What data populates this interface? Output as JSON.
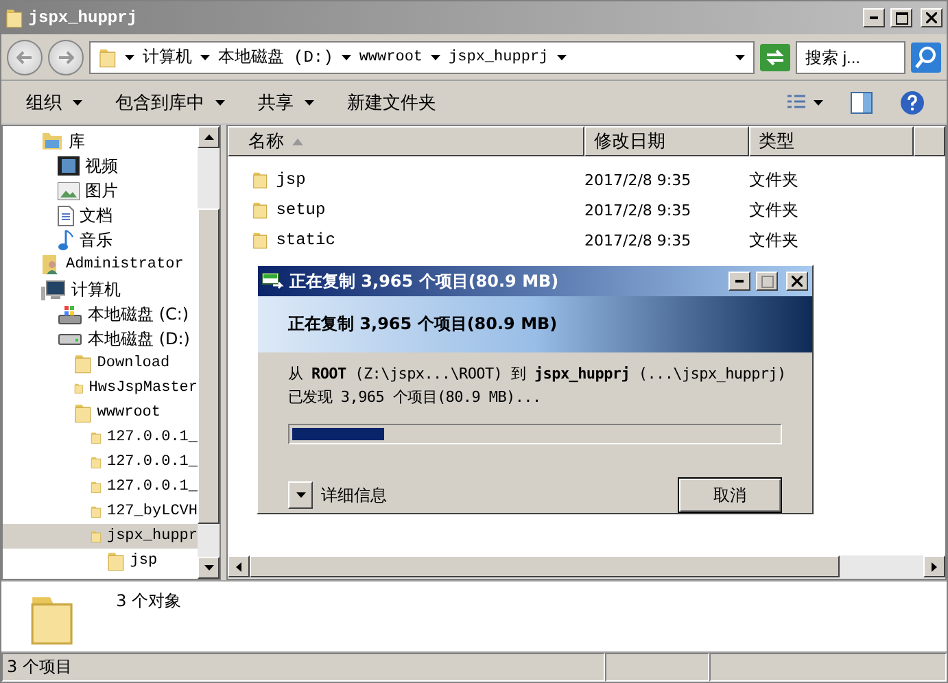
{
  "window": {
    "title": "jspx_hupprj"
  },
  "address_bar": {
    "path": [
      "计算机",
      "本地磁盘 (D:)",
      "wwwroot",
      "jspx_hupprj"
    ],
    "search": {
      "placeholder": "搜索 j..."
    }
  },
  "toolbar": {
    "items": [
      {
        "label": "组织",
        "dropdown": true
      },
      {
        "label": "包含到库中",
        "dropdown": true
      },
      {
        "label": "共享",
        "dropdown": true
      },
      {
        "label": "新建文件夹",
        "dropdown": false
      }
    ]
  },
  "sidebar": {
    "items": [
      {
        "label": "库",
        "kind": "library",
        "selected": false,
        "children": [
          {
            "label": "视频",
            "kind": "video",
            "selected": false
          },
          {
            "label": "图片",
            "kind": "picture",
            "selected": false
          },
          {
            "label": "文档",
            "kind": "document",
            "selected": false
          },
          {
            "label": "音乐",
            "kind": "music",
            "selected": false
          }
        ]
      },
      {
        "label": "Administrator",
        "kind": "user",
        "selected": false
      },
      {
        "label": "计算机",
        "kind": "computer",
        "selected": false,
        "children": [
          {
            "label": "本地磁盘 (C:)",
            "kind": "system-drive",
            "selected": false
          },
          {
            "label": "本地磁盘 (D:)",
            "kind": "drive",
            "selected": false,
            "children": [
              {
                "label": "Download",
                "kind": "folder",
                "selected": false
              },
              {
                "label": "HwsJspMaster",
                "kind": "folder",
                "selected": false
              },
              {
                "label": "wwwroot",
                "kind": "folder",
                "selected": false,
                "children": [
                  {
                    "label": "127.0.0.1_",
                    "kind": "folder",
                    "selected": false
                  },
                  {
                    "label": "127.0.0.1_",
                    "kind": "folder",
                    "selected": false
                  },
                  {
                    "label": "127.0.0.1_",
                    "kind": "folder",
                    "selected": false
                  },
                  {
                    "label": "127_byLCVH",
                    "kind": "folder",
                    "selected": false
                  },
                  {
                    "label": "jspx_huppr",
                    "kind": "folder",
                    "selected": true,
                    "children": [
                      {
                        "label": "jsp",
                        "kind": "folder",
                        "selected": false
                      }
                    ]
                  }
                ]
              }
            ]
          }
        ]
      }
    ]
  },
  "table": {
    "columns": [
      {
        "label": "名称",
        "sorted": true
      },
      {
        "label": "修改日期",
        "sorted": false
      },
      {
        "label": "类型",
        "sorted": false
      }
    ],
    "rows": [
      {
        "name": "jsp",
        "modified": "2017/2/8 9:35",
        "type": "文件夹"
      },
      {
        "name": "setup",
        "modified": "2017/2/8 9:35",
        "type": "文件夹"
      },
      {
        "name": "static",
        "modified": "2017/2/8 9:35",
        "type": "文件夹"
      }
    ]
  },
  "details_pane": {
    "text": "3 个对象"
  },
  "status_bar": {
    "text": "3 个项目"
  },
  "copy_dialog": {
    "title": "正在复制 3,965 个项目(80.9 MB)",
    "heading": "正在复制 3,965 个项目(80.9 MB)",
    "from_to": "从 **ROOT** (Z:\\jspx...\\ROOT) 到 **jspx_hupprj** (...\\jspx_hupprj)",
    "found": "已发现 3,965 个项目(80.9 MB)...",
    "progress": {
      "level": 0.19
    },
    "details_label": "详细信息",
    "cancel": "取消"
  }
}
